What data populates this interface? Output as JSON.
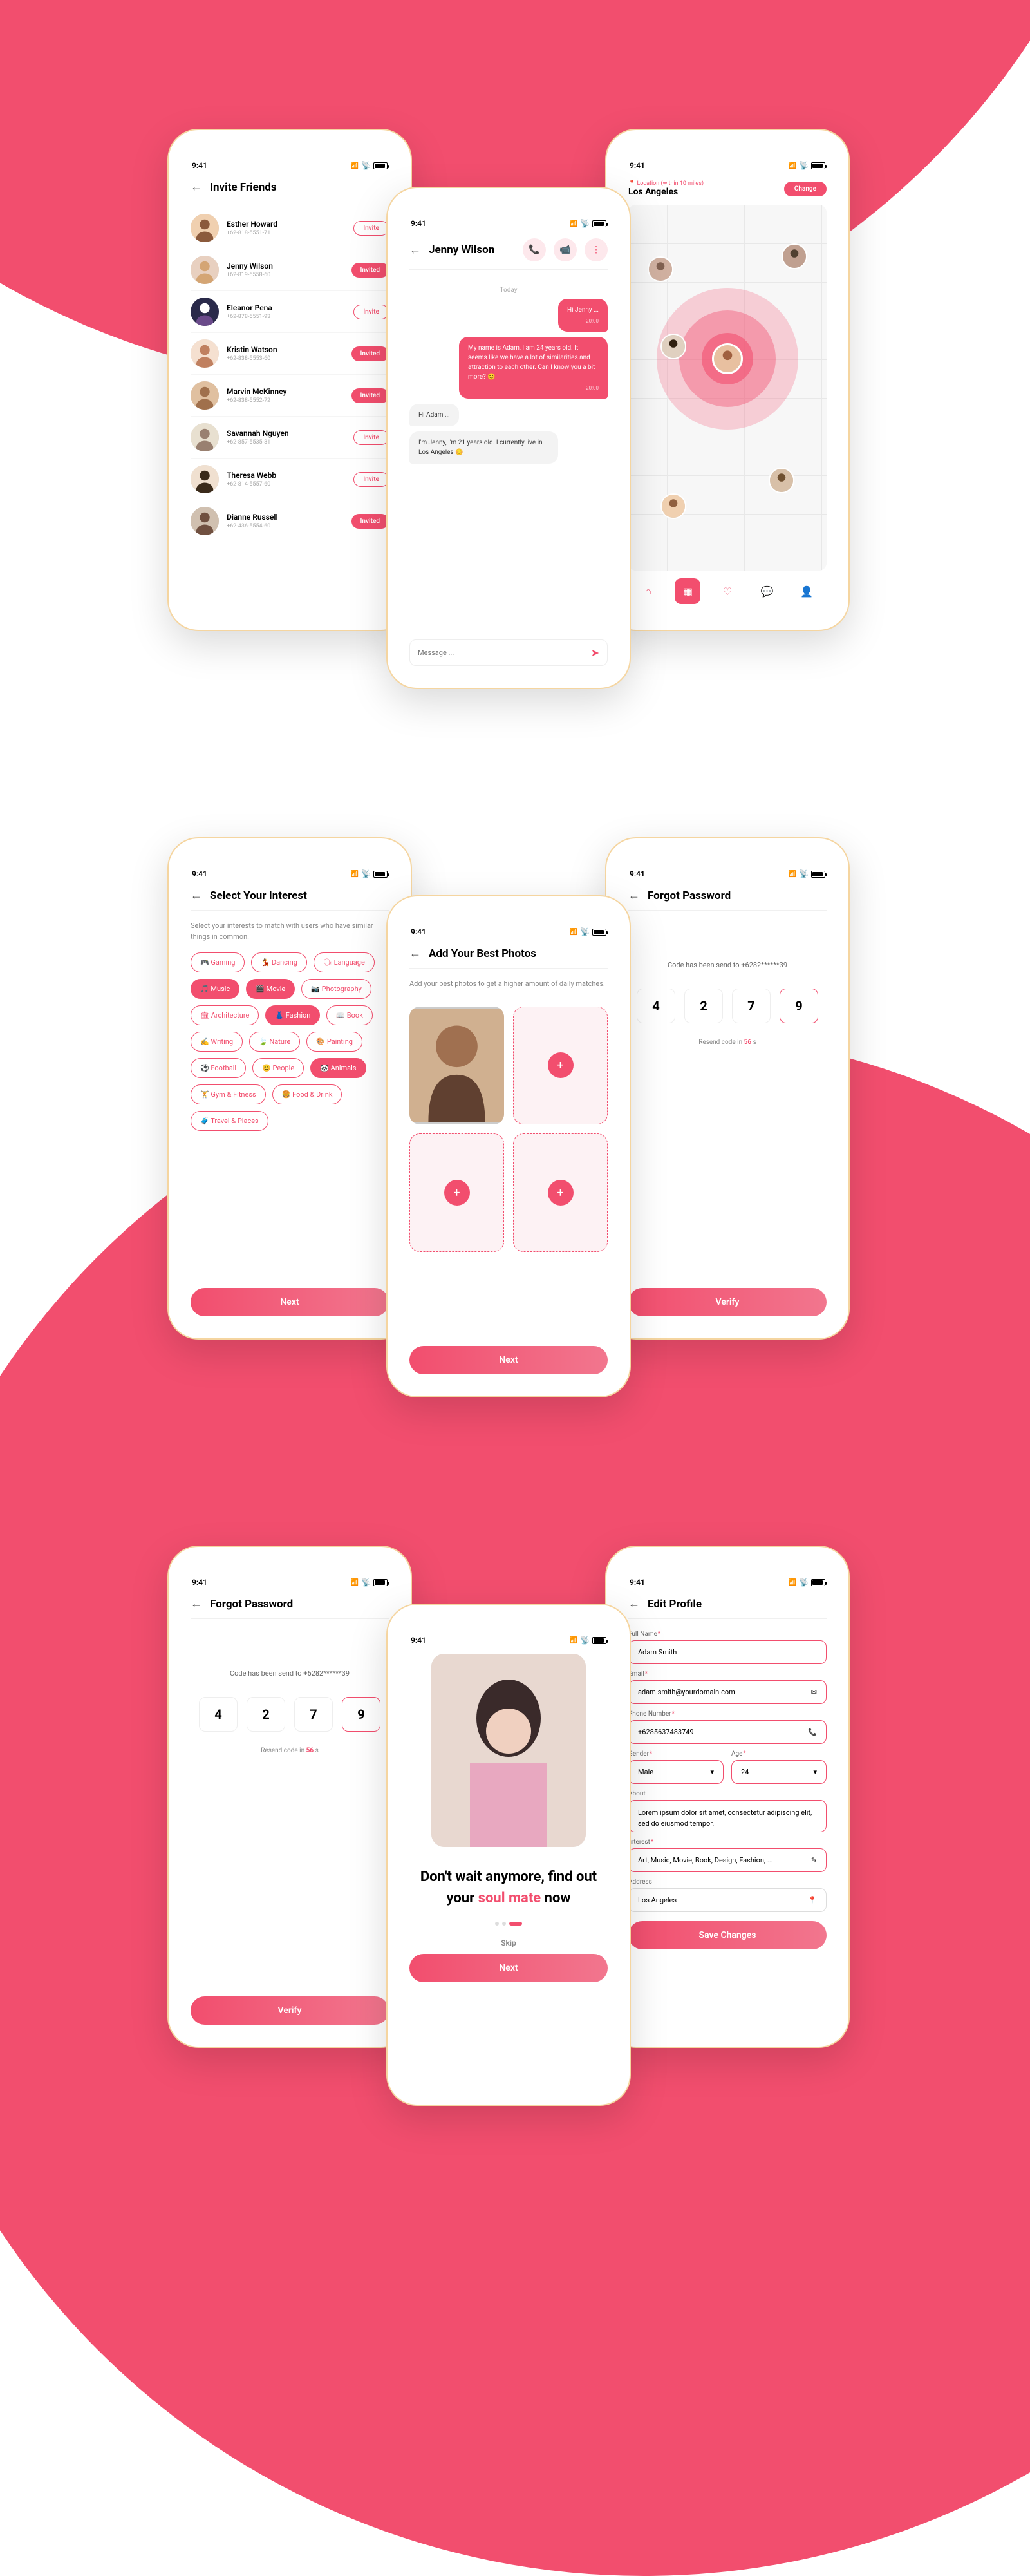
{
  "status_time": "9:41",
  "row1": {
    "invite": {
      "title": "Invite Friends",
      "friends": [
        {
          "name": "Esther Howard",
          "phone": "+62-818-5551-71",
          "state": "Invite"
        },
        {
          "name": "Jenny Wilson",
          "phone": "+62-819-5558-60",
          "state": "Invited"
        },
        {
          "name": "Eleanor Pena",
          "phone": "+62-878-5551-93",
          "state": "Invite"
        },
        {
          "name": "Kristin Watson",
          "phone": "+62-838-5553-60",
          "state": "Invited"
        },
        {
          "name": "Marvin McKinney",
          "phone": "+62-838-5552-72",
          "state": "Invited"
        },
        {
          "name": "Savannah Nguyen",
          "phone": "+62-857-5535-31",
          "state": "Invite"
        },
        {
          "name": "Theresa Webb",
          "phone": "+62-814-5557-60",
          "state": "Invite"
        },
        {
          "name": "Dianne Russell",
          "phone": "+62-436-5554-60",
          "state": "Invited"
        }
      ]
    },
    "chat": {
      "name": "Jenny Wilson",
      "day": "Today",
      "messages": [
        {
          "dir": "out",
          "text": "Hi Jenny ...",
          "time": "20:00"
        },
        {
          "dir": "out",
          "text": "My name is Adam, I am 24 years old. It seems like we have a lot of similarities and attraction to each other. Can I know you a bit more? 😊",
          "time": "20:00"
        },
        {
          "dir": "in",
          "text": "Hi Adam ...",
          "time": ""
        },
        {
          "dir": "in",
          "text": "I'm Jenny, I'm 21 years old. I currently live in Los Angeles 😊",
          "time": ""
        }
      ],
      "placeholder": "Message ..."
    },
    "map": {
      "loc_label": "📍 Location (within 10 miles)",
      "location": "Los Angeles",
      "change": "Change"
    }
  },
  "row2": {
    "interests": {
      "title": "Select Your Interest",
      "sub": "Select your interests to match with users who have similar things in common.",
      "items": [
        {
          "t": "🎮 Gaming",
          "s": 0
        },
        {
          "t": "💃 Dancing",
          "s": 0
        },
        {
          "t": "🗣 Language",
          "s": 0
        },
        {
          "t": "🎵 Music",
          "s": 1
        },
        {
          "t": "🎬 Movie",
          "s": 1
        },
        {
          "t": "📷 Photography",
          "s": 0
        },
        {
          "t": "🏛 Architecture",
          "s": 0
        },
        {
          "t": "👗 Fashion",
          "s": 1
        },
        {
          "t": "📖 Book",
          "s": 0
        },
        {
          "t": "✍️ Writing",
          "s": 0
        },
        {
          "t": "🍃 Nature",
          "s": 0
        },
        {
          "t": "🎨 Painting",
          "s": 0
        },
        {
          "t": "⚽ Football",
          "s": 0
        },
        {
          "t": "😊 People",
          "s": 0
        },
        {
          "t": "🐼 Animals",
          "s": 1
        },
        {
          "t": "🏋 Gym & Fitness",
          "s": 0
        },
        {
          "t": "🍔 Food & Drink",
          "s": 0
        },
        {
          "t": "🧳 Travel & Places",
          "s": 0
        }
      ],
      "next": "Next"
    },
    "photos": {
      "title": "Add Your Best Photos",
      "sub": "Add your best photos to get a higher amount of daily matches.",
      "next": "Next"
    },
    "forgot": {
      "title": "Forgot Password",
      "msg": "Code has been send to +6282******39",
      "code": [
        "4",
        "2",
        "7",
        "9"
      ],
      "resend_a": "Resend code in ",
      "resend_b": "56",
      "resend_c": " s",
      "verify": "Verify"
    }
  },
  "row3": {
    "onboard": {
      "t1": "Don't wait anymore, find out your ",
      "accent": "soul mate",
      "t2": " now",
      "skip": "Skip",
      "next": "Next"
    },
    "profile": {
      "title": "Edit Profile",
      "labels": {
        "full": "Full Name",
        "email": "Email",
        "phone": "Phone Number",
        "gender": "Gender",
        "age": "Age",
        "about": "About",
        "interest": "Interest",
        "address": "Address"
      },
      "full": "Adam Smith",
      "email": "adam.smith@yourdomain.com",
      "phone": "+6285637483749",
      "gender": "Male",
      "age": "24",
      "about": "Lorem ipsum dolor sit amet, consectetur adipiscing elit, sed do eiusmod tempor.",
      "interest": "Art, Music, Movie, Book, Design, Fashion, ...",
      "address": "Los Angeles",
      "save": "Save Changes"
    }
  }
}
